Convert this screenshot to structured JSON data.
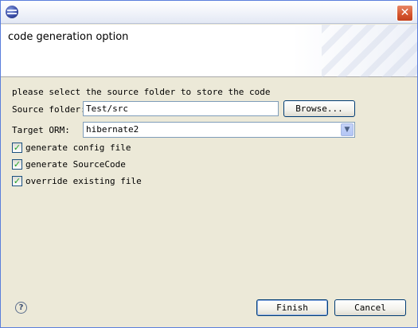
{
  "window": {
    "close_glyph": "✕"
  },
  "header": {
    "title": "code generation option"
  },
  "form": {
    "instruction": "please select the source folder to store the code",
    "source_folder_label": "Source folder:",
    "source_folder_value": "Test/src",
    "browse_label": "Browse...",
    "target_orm_label": "Target ORM:",
    "target_orm_value": "hibernate2",
    "options": [
      {
        "label": "generate config file",
        "checked": true
      },
      {
        "label": "generate SourceCode",
        "checked": true
      },
      {
        "label": "override existing file",
        "checked": true
      }
    ]
  },
  "footer": {
    "help_glyph": "?",
    "finish_label": "Finish",
    "cancel_label": "Cancel"
  },
  "icons": {
    "app": "eclipse-icon",
    "close": "close-icon",
    "help": "help-icon",
    "dropdown": "chevron-down-icon",
    "check": "checkmark-icon"
  }
}
